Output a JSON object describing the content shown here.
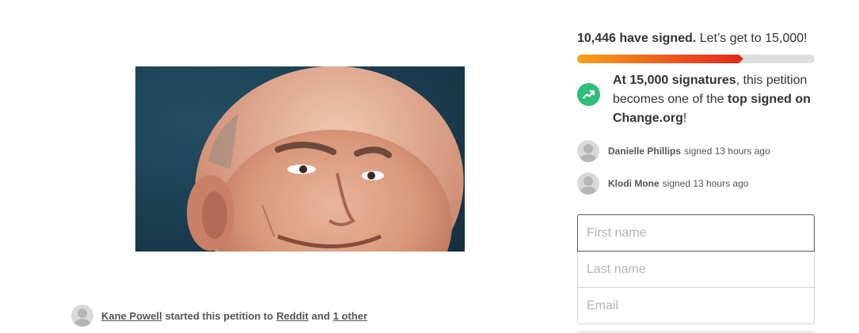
{
  "petition": {
    "starter_name": "Kane Powell",
    "started_text": "started this petition to",
    "target": "Reddit",
    "and_text": "and",
    "others_link": "1 other"
  },
  "progress": {
    "signed_count": "10,446 have signed.",
    "goal_text": "Let’s get to 15,000!",
    "fraction": 0.7
  },
  "goal_message": {
    "bold_lead": "At 15,000 signatures",
    "middle": ", this petition becomes one of the ",
    "bold_tail": "top signed on Change.org",
    "end": "!"
  },
  "recent_signers": [
    {
      "name": "Danielle Phillips",
      "action": "signed 13 hours ago"
    },
    {
      "name": "Klodi Mone",
      "action": "signed 13 hours ago"
    }
  ],
  "form": {
    "first_name_placeholder": "First name",
    "last_name_placeholder": "Last name",
    "email_placeholder": "Email"
  },
  "colors": {
    "progress_start": "#f7a11a",
    "progress_end": "#e0281e",
    "goal_icon_bg": "#2dbe7a"
  },
  "icons": {
    "goal": "trending-up-icon"
  }
}
